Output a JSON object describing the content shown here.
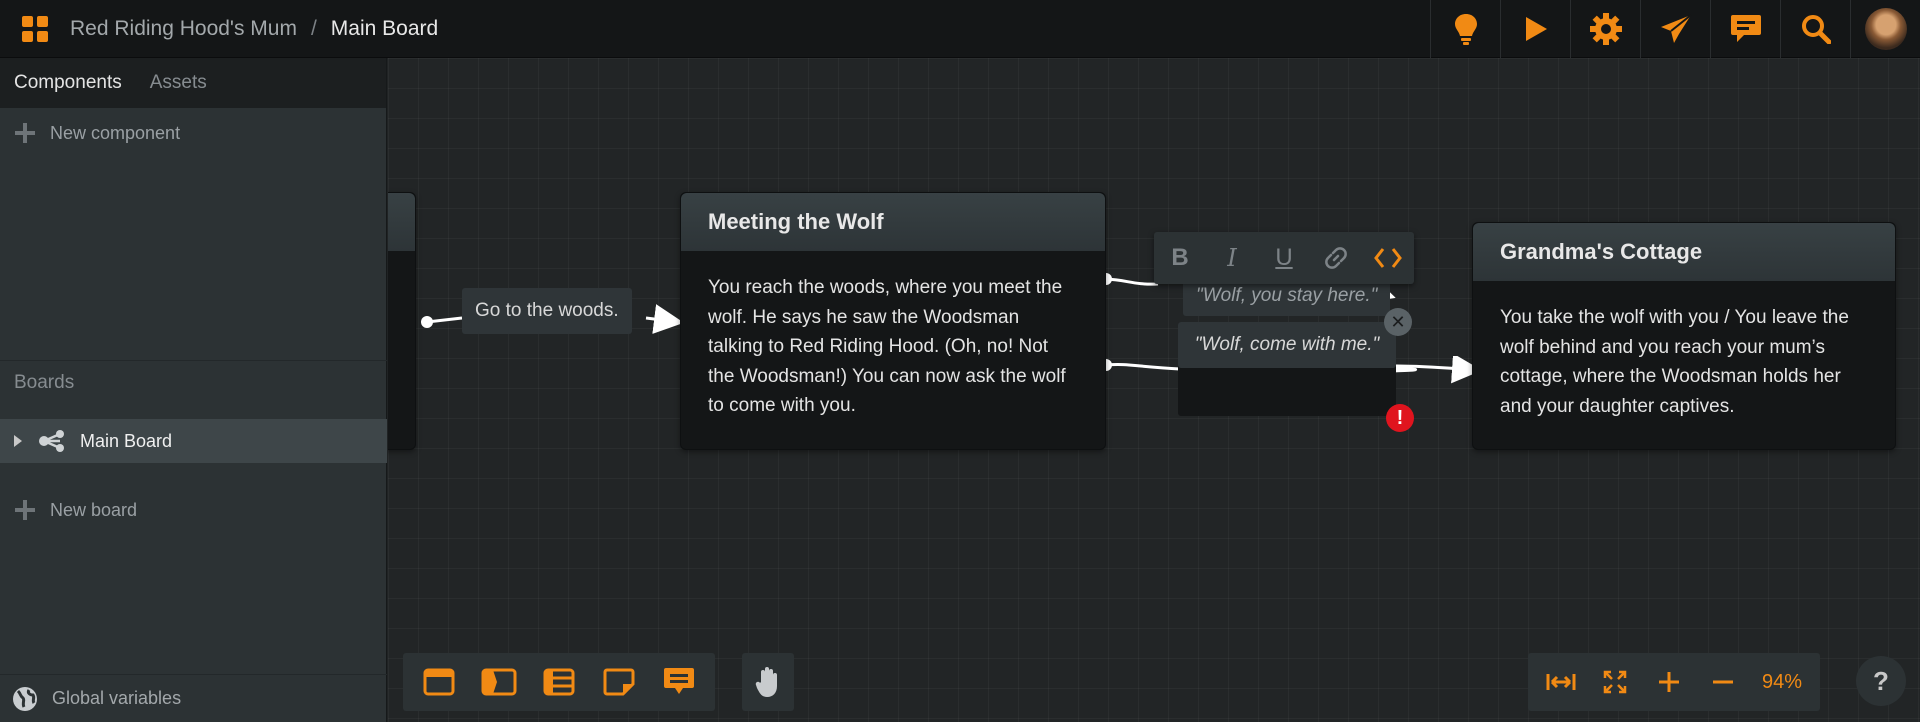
{
  "header": {
    "project": "Red Riding Hood's Mum",
    "separator": "/",
    "current_board": "Main Board",
    "icons": [
      "apps-grid-icon",
      "lightbulb-icon",
      "play-icon",
      "gear-icon",
      "send-icon",
      "comment-icon",
      "search-icon",
      "avatar"
    ]
  },
  "sidebar": {
    "tabs": [
      {
        "label": "Components"
      },
      {
        "label": "Assets"
      }
    ],
    "new_component": "New component",
    "boards_heading": "Boards",
    "boards": [
      {
        "label": "Main Board"
      }
    ],
    "new_board": "New board",
    "global_variables": "Global variables"
  },
  "canvas": {
    "connection_go_woods": "Go to the woods.",
    "node_wolf": {
      "title": "Meeting the Wolf",
      "body": "You reach the woods, where you meet the wolf. He says he saw the Woodsman talking to Red Riding Hood. (Oh, no! Not the Woodsman!) You can now ask the wolf to come with you."
    },
    "node_grandma": {
      "title": "Grandma's Cottage",
      "body": "You take the wolf with you / You leave the wolf behind and you reach your mum’s cottage, where the Woodsman holds her and your daughter captives."
    },
    "choice_stay": "\"Wolf, you stay here.\"",
    "choice_come": "\"Wolf, come with me.\"",
    "format_toolbar": [
      "bold-icon",
      "italic-icon",
      "underline-icon",
      "link-icon",
      "code-icon"
    ],
    "bottom_tools": [
      "flow-fragment-icon",
      "dialogue-icon",
      "hub-icon",
      "note-icon",
      "comment-icon",
      "hand-icon"
    ],
    "zoom": {
      "tools": [
        "fit-width-icon",
        "fit-screen-icon",
        "zoom-in-icon",
        "zoom-out-icon"
      ],
      "level": "94%"
    },
    "help": "?"
  },
  "colors": {
    "accent": "#f18a14",
    "background": "#222526",
    "node_body": "#141617",
    "error": "#e0141e"
  }
}
